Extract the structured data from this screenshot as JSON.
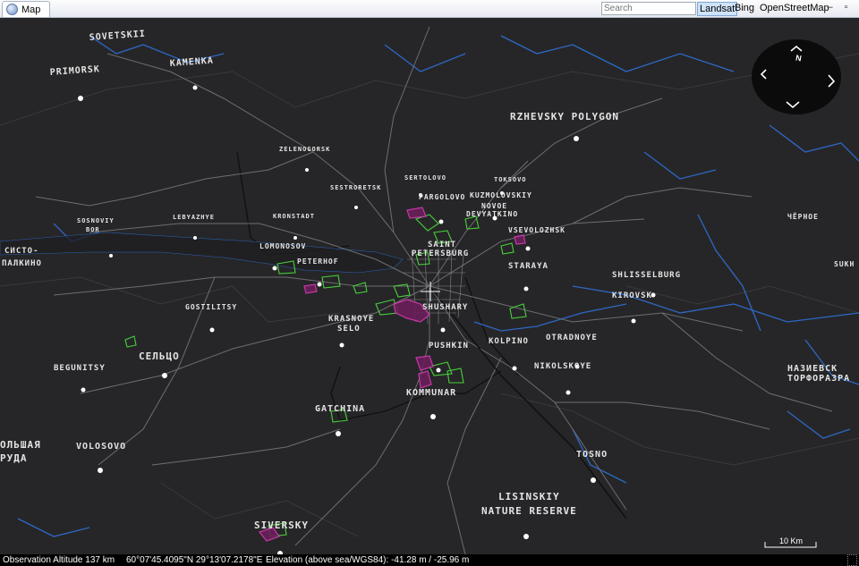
{
  "window": {
    "tab_title": "Map",
    "search_placeholder": "Search"
  },
  "sources": [
    {
      "label": "Landsat",
      "active": true
    },
    {
      "label": "Bing",
      "active": false
    },
    {
      "label": "OpenStreetMap",
      "active": false
    }
  ],
  "compass": {
    "north_label": "N"
  },
  "places": [
    {
      "label": "SOVETSKII",
      "size": 10,
      "rot": -4
    },
    {
      "label": "PRIMORSK",
      "size": 10,
      "rot": -4
    },
    {
      "label": "KAMENKA",
      "size": 10,
      "rot": -4
    },
    {
      "label": "RZHEVSKY POLYGON",
      "size": 11,
      "rot": 0
    },
    {
      "label": "ZELENOGORSK",
      "size": 7,
      "rot": 0
    },
    {
      "label": "SESTRORETSK",
      "size": 7,
      "rot": 0
    },
    {
      "label": "SERTOLOVO",
      "size": 7,
      "rot": 0
    },
    {
      "label": "TOKSOVO",
      "size": 7,
      "rot": 0
    },
    {
      "label": "PARGOLOVO",
      "size": 8,
      "rot": 0
    },
    {
      "label": "KUZMOLOVSKIY",
      "size": 8,
      "rot": 0
    },
    {
      "label": "NOVOE",
      "size": 8,
      "rot": 0
    },
    {
      "label": "DEVYATKINO",
      "size": 8,
      "rot": 0
    },
    {
      "label": "SOSNOVIY",
      "size": 7,
      "rot": 0
    },
    {
      "label": "BOR",
      "size": 7,
      "rot": 0
    },
    {
      "label": "LEBYAZHYE",
      "size": 7,
      "rot": 0
    },
    {
      "label": "KRONSTADT",
      "size": 7,
      "rot": 0
    },
    {
      "label": "VSEVOLOZHSK",
      "size": 8,
      "rot": 0
    },
    {
      "label": "ЧЁРНОЕ",
      "size": 8,
      "rot": 0
    },
    {
      "label": "СИСТО-",
      "size": 9,
      "rot": 0
    },
    {
      "label": "ПАЛКИНО",
      "size": 9,
      "rot": 0
    },
    {
      "label": "LOMONOSOV",
      "size": 8,
      "rot": 0
    },
    {
      "label": "PETERHOF",
      "size": 8,
      "rot": 0
    },
    {
      "label": "SAINT",
      "size": 9,
      "rot": 0
    },
    {
      "label": "PETERSBURG",
      "size": 9,
      "rot": 0
    },
    {
      "label": "STARAYA",
      "size": 9,
      "rot": 0
    },
    {
      "label": "SHLISSELBURG",
      "size": 9,
      "rot": 0
    },
    {
      "label": "SUKH",
      "size": 8,
      "rot": 0
    },
    {
      "label": "KIROVSK",
      "size": 9,
      "rot": 0
    },
    {
      "label": "GOSTILITSY",
      "size": 8,
      "rot": 0
    },
    {
      "label": "SHUSHARY",
      "size": 9,
      "rot": 0
    },
    {
      "label": "KRASNOYE",
      "size": 9,
      "rot": 0
    },
    {
      "label": "SELO",
      "size": 9,
      "rot": 0
    },
    {
      "label": "PUSHKIN",
      "size": 9,
      "rot": 0
    },
    {
      "label": "KOLPINO",
      "size": 9,
      "rot": 0
    },
    {
      "label": "OTRADNOYE",
      "size": 9,
      "rot": 0
    },
    {
      "label": "СЕЛЬЦО",
      "size": 11,
      "rot": 0
    },
    {
      "label": "BEGUNITSY",
      "size": 9,
      "rot": 0
    },
    {
      "label": "NIKOLSKOYE",
      "size": 9,
      "rot": 0
    },
    {
      "label": "НАЗИЕВСК",
      "size": 10,
      "rot": 0
    },
    {
      "label": "ТОРФОРАЗРА",
      "size": 10,
      "rot": 0
    },
    {
      "label": "KOMMUNAR",
      "size": 10,
      "rot": 0
    },
    {
      "label": "GATCHINA",
      "size": 10,
      "rot": 0
    },
    {
      "label": "ОЛЬШАЯ",
      "size": 11,
      "rot": 0
    },
    {
      "label": "РУДА",
      "size": 11,
      "rot": 0
    },
    {
      "label": "VOLOSOVO",
      "size": 10,
      "rot": 0
    },
    {
      "label": "TOSNO",
      "size": 10,
      "rot": 0
    },
    {
      "label": "LISINSKIY",
      "size": 11,
      "rot": 0
    },
    {
      "label": "NATURE RESERVE",
      "size": 11,
      "rot": 0
    },
    {
      "label": "SIVERSKY",
      "size": 11,
      "rot": 0
    }
  ],
  "scale_bar": {
    "label": "10 Km"
  },
  "status": {
    "altitude": "Observation Altitude 137 km",
    "coordinates": "60°07'45.4095\"N 29°13'07.2178\"E",
    "elevation": "Elevation (above sea/WGS84): -41.28 m / -25.96 m"
  },
  "colors": {
    "background": "#262628",
    "roads": "#6e6e72",
    "water": "#2f6fd6",
    "parks": "#47d13a",
    "districts": "#d63ab4"
  }
}
